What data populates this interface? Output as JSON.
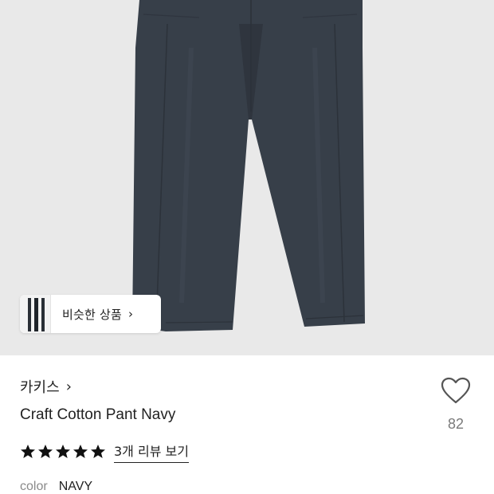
{
  "similar": {
    "label": "비슷한 상품",
    "arrow": "›"
  },
  "product": {
    "brand": "카키스",
    "brand_arrow": "›",
    "name": "Craft Cotton Pant Navy",
    "likes": "82",
    "rating_stars": 5,
    "reviews_link": "3개 리뷰 보기",
    "color_label": "color",
    "color_value": "NAVY"
  },
  "colors": {
    "pants": "#373f49",
    "background": "#e9e9e9",
    "text": "#222222",
    "muted": "#8a8a8a"
  },
  "icons": {
    "like": "heart-outline-icon",
    "star": "star-filled-icon",
    "chevron": "chevron-right-icon"
  }
}
